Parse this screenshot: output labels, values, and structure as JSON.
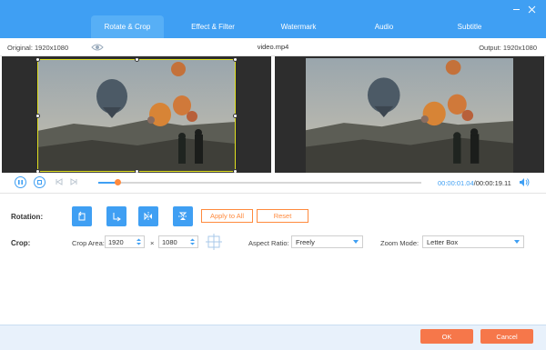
{
  "window": {
    "minimize_icon": "minimize-icon",
    "close_icon": "close-icon"
  },
  "tabs": [
    {
      "label": "Rotate & Crop",
      "active": true
    },
    {
      "label": "Effect & Filter",
      "active": false
    },
    {
      "label": "Watermark",
      "active": false
    },
    {
      "label": "Audio",
      "active": false
    },
    {
      "label": "Subtitle",
      "active": false
    }
  ],
  "info": {
    "original": "Original: 1920x1080",
    "filename": "video.mp4",
    "output": "Output: 1920x1080"
  },
  "player": {
    "current_time": "00:00:01.04",
    "separator": "/",
    "duration": "00:00:19.11",
    "progress": 0.06
  },
  "rotation": {
    "label": "Rotation:",
    "apply_all": "Apply to All",
    "reset": "Reset",
    "buttons": [
      "rotate-left-icon",
      "rotate-right-icon",
      "flip-horizontal-icon",
      "flip-vertical-icon"
    ]
  },
  "crop": {
    "label": "Crop:",
    "area_label": "Crop Area:",
    "width": "1920",
    "times": "×",
    "height": "1080",
    "aspect_label": "Aspect Ratio:",
    "aspect_value": "Freely",
    "zoom_label": "Zoom Mode:",
    "zoom_value": "Letter Box"
  },
  "footer": {
    "ok": "OK",
    "cancel": "Cancel"
  },
  "colors": {
    "accent": "#3f9ff3",
    "orange": "#ff8a3d",
    "button": "#f6774a"
  }
}
